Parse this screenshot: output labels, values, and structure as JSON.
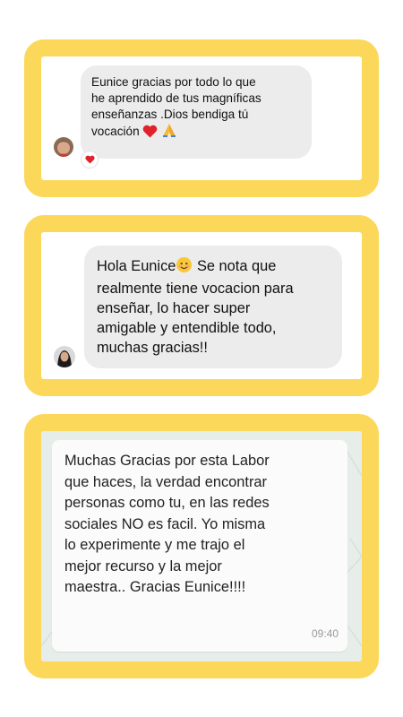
{
  "card1": {
    "message_lines": [
      "Eunice gracias por todo lo que",
      "he aprendido de tus magníficas",
      "enseñanzas .Dios bendiga tú",
      "vocación"
    ],
    "message_emojis": [
      "heart-icon",
      "praying-hands-icon"
    ],
    "reaction_icon": "heart-icon",
    "accent": "#fcd85a"
  },
  "card2": {
    "message_first": "Hola Eunice",
    "message_emoji": "smiling-face-icon",
    "message_rest": "Se nota que\nrealmente tiene vocacion para\nenseñar, lo hacer super\namigable y entendible todo,\nmuchas gracias!!"
  },
  "card3": {
    "message": "Muchas Gracias por esta Labor\nque haces, la verdad encontrar\npersonas como tu, en las redes\nsociales NO es facil. Yo misma\nlo experimente y me trajo el\nmejor recurso y la mejor\nmaestra.. Gracias Eunice!!!!",
    "time": "09:40"
  }
}
